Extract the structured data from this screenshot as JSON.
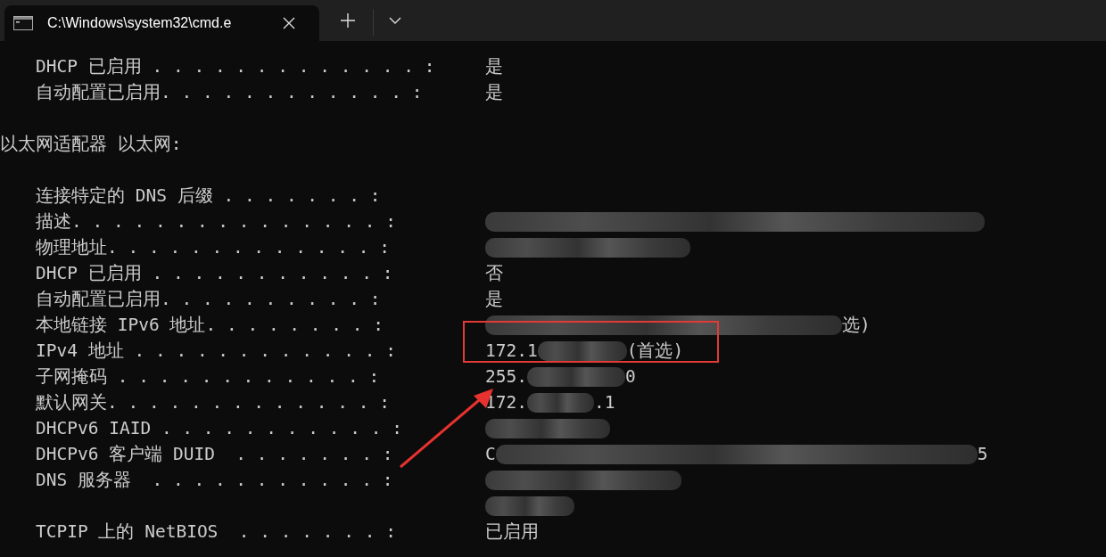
{
  "window": {
    "tab_title": "C:\\Windows\\system32\\cmd.e"
  },
  "lines": [
    {
      "kind": "field",
      "label": "DHCP 已启用 . . . . . . . . . . . . . :",
      "parts": [
        {
          "kind": "text",
          "text": "是"
        }
      ]
    },
    {
      "kind": "field",
      "label": "自动配置已启用. . . . . . . . . . . . :",
      "parts": [
        {
          "kind": "text",
          "text": "是"
        }
      ]
    },
    {
      "kind": "blank"
    },
    {
      "kind": "heading",
      "text": "以太网适配器 以太网:"
    },
    {
      "kind": "blank"
    },
    {
      "kind": "field",
      "label": "连接特定的 DNS 后缀 . . . . . . . :"
    },
    {
      "kind": "field",
      "label": "描述. . . . . . . . . . . . . . . :",
      "parts": [
        {
          "kind": "redaction"
        }
      ]
    },
    {
      "kind": "field",
      "label": "物理地址. . . . . . . . . . . . . :",
      "parts": [
        {
          "kind": "redaction"
        }
      ]
    },
    {
      "kind": "field",
      "label": "DHCP 已启用 . . . . . . . . . . . :",
      "parts": [
        {
          "kind": "text",
          "text": "否"
        }
      ]
    },
    {
      "kind": "field",
      "label": "自动配置已启用. . . . . . . . . . :",
      "parts": [
        {
          "kind": "text",
          "text": "是"
        }
      ]
    },
    {
      "kind": "field",
      "label": "本地链接 IPv6 地址. . . . . . . . :",
      "parts": [
        {
          "kind": "redaction"
        },
        {
          "kind": "text",
          "text": "选)"
        }
      ]
    },
    {
      "kind": "field",
      "label": "IPv4 地址 . . . . . . . . . . . . :",
      "highlighted": true,
      "parts": [
        {
          "kind": "text",
          "text": "172.1"
        },
        {
          "kind": "redaction"
        },
        {
          "kind": "text",
          "text": "(首选)"
        }
      ]
    },
    {
      "kind": "field",
      "label": "子网掩码 . . . . . . . . . . . . :",
      "parts": [
        {
          "kind": "text",
          "text": "255."
        },
        {
          "kind": "redaction"
        },
        {
          "kind": "text",
          "text": "0"
        }
      ]
    },
    {
      "kind": "field",
      "label": "默认网关. . . . . . . . . . . . . :",
      "arrow": true,
      "parts": [
        {
          "kind": "text",
          "text": "172."
        },
        {
          "kind": "redaction"
        },
        {
          "kind": "text",
          "text": ".1"
        }
      ]
    },
    {
      "kind": "field",
      "label": "DHCPv6 IAID . . . . . . . . . . . :",
      "parts": [
        {
          "kind": "redaction"
        }
      ]
    },
    {
      "kind": "field",
      "label": "DHCPv6 客户端 DUID  . . . . . . . :",
      "parts": [
        {
          "kind": "text",
          "text": "C"
        },
        {
          "kind": "redaction"
        },
        {
          "kind": "text",
          "text": "5"
        }
      ]
    },
    {
      "kind": "field",
      "label": "DNS 服务器  . . . . . . . . . . . :",
      "parts": [
        {
          "kind": "redaction"
        }
      ]
    },
    {
      "kind": "continuation",
      "parts": [
        {
          "kind": "redaction"
        }
      ]
    },
    {
      "kind": "field",
      "label": "TCPIP 上的 NetBIOS  . . . . . . . :",
      "parts": [
        {
          "kind": "text",
          "text": "已启用"
        }
      ]
    }
  ]
}
